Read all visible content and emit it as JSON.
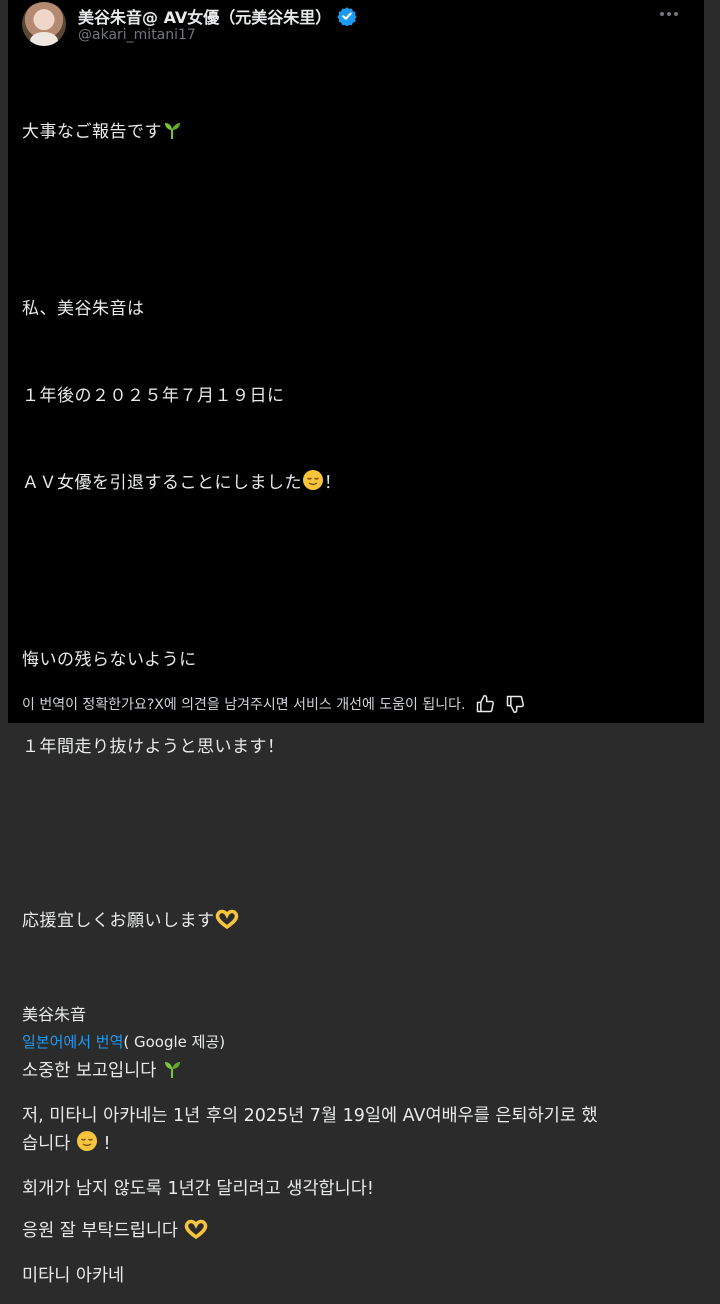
{
  "author": {
    "display_name": "美谷朱音@ AV女優（元美谷朱里）",
    "handle": "@akari_mitani17"
  },
  "post_jp": {
    "line1": "大事なご報告です",
    "line2": "私、美谷朱音は",
    "line3": "１年後の２０２５年７月１９日に",
    "line4": "ＡＶ女優を引退することにしました",
    "line4_end": "！",
    "line5": "悔いの残らないように",
    "line6": "１年間走り抜けようと思います！",
    "line7": "応援宜しくお願いします",
    "signature": "美谷朱音"
  },
  "translation": {
    "link": "일본어에서 번역",
    "source": "( Google 제공)"
  },
  "post_ko": {
    "p1": "소중한 보고입니다",
    "p2a": "저, 미타니 아카네는 1년 후의 2025년 7월 19일에 AV여배우를 은퇴하기로 했",
    "p2b": "습니다",
    "p2b_end": "!",
    "p3": "회개가 남지 않도록 1년간 달리려고 생각합니다!",
    "p4": "응원 잘 부탁드립니다",
    "p5": "미타니 아카네"
  },
  "feedback": {
    "text": "이 번역이 정확한가요?X에 의견을 남겨주시면 서비스 개선에 도움이 됩니다."
  },
  "icons": {
    "verified": "verified-badge-icon",
    "more": "more-options-icon",
    "sprout": "seedling-emoji",
    "relieved": "relieved-face-emoji",
    "heart_hands": "heart-hands-emoji",
    "thumbs_up": "thumbs-up-icon",
    "thumbs_down": "thumbs-down-icon"
  },
  "colors": {
    "background": "#000000",
    "text": "#e7e9ea",
    "muted": "#71767b",
    "link": "#1d9bf0",
    "verified": "#1d9bf0"
  }
}
